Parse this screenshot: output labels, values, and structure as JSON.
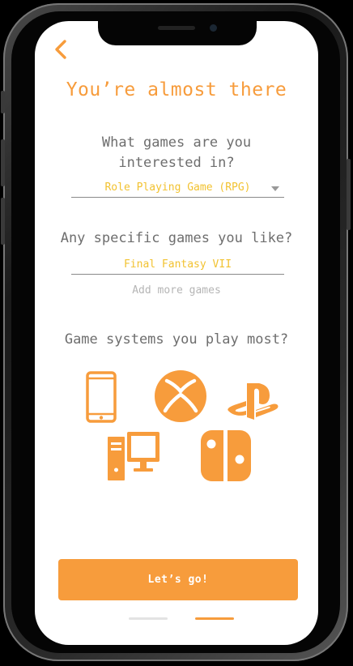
{
  "screen": {
    "title": "You’re almost there",
    "question_games": "What games are you interested in?",
    "genre_select": {
      "selected": "Role Playing Game (RPG)"
    },
    "question_specific": "Any specific games you like?",
    "specific_game_value": "Final Fantasy VII",
    "add_more_label": "Add more games",
    "question_systems": "Game systems you play most?",
    "systems": [
      "mobile-icon",
      "xbox-icon",
      "playstation-icon",
      "pc-icon",
      "switch-icon"
    ],
    "cta_label": "Let’s go!",
    "pagination": {
      "total": 2,
      "current": 2
    }
  },
  "colors": {
    "accent": "#f79c3c",
    "field_text": "#f2c230",
    "muted_text": "#6e6e6e"
  }
}
